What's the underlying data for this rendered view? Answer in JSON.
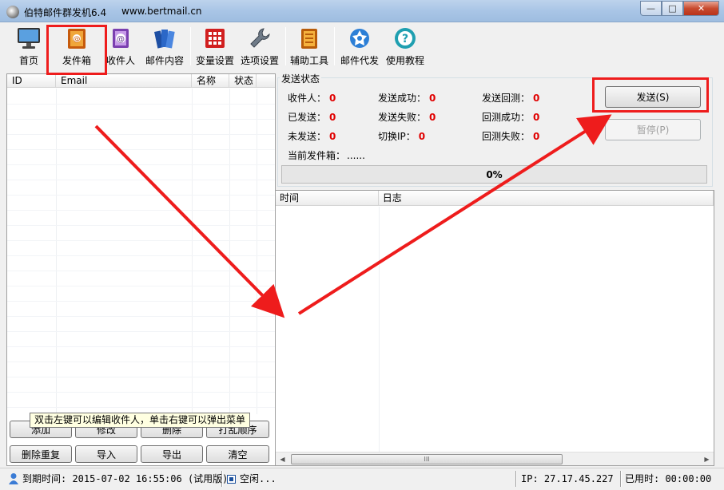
{
  "window": {
    "title": "伯特邮件群发机6.4",
    "url": "www.bertmail.cn",
    "minimize": "—",
    "maximize": "□",
    "close": "✕"
  },
  "toolbar": {
    "items": [
      {
        "label": "首页",
        "icon": "monitor-icon"
      },
      {
        "label": "发件箱",
        "icon": "outbox-icon"
      },
      {
        "label": "收件人",
        "icon": "recipients-icon"
      },
      {
        "label": "邮件内容",
        "icon": "mail-content-icon"
      },
      {
        "label": "变量设置",
        "icon": "variables-icon"
      },
      {
        "label": "选项设置",
        "icon": "wrench-icon"
      },
      {
        "label": "辅助工具",
        "icon": "tools-icon"
      },
      {
        "label": "邮件代发",
        "icon": "proxy-send-icon"
      },
      {
        "label": "使用教程",
        "icon": "help-icon"
      }
    ]
  },
  "recipient_list": {
    "columns": [
      "ID",
      "Email",
      "名称",
      "状态"
    ],
    "buttons_row1": [
      "添加",
      "修改",
      "删除",
      "打乱顺序"
    ],
    "buttons_row2": [
      "删除重复",
      "导入",
      "导出",
      "清空"
    ],
    "tooltip": "双击左键可以编辑收件人，单击右键可以弹出菜单"
  },
  "send_status": {
    "group_label": "发送状态",
    "stats": [
      {
        "label": "收件人：",
        "value": "0"
      },
      {
        "label": "发送成功：",
        "value": "0"
      },
      {
        "label": "发送回测：",
        "value": "0"
      },
      {
        "label": "已发送：",
        "value": "0"
      },
      {
        "label": "发送失败：",
        "value": "0"
      },
      {
        "label": "回测成功：",
        "value": "0"
      },
      {
        "label": "未发送：",
        "value": "0"
      },
      {
        "label": "切换IP：",
        "value": "0"
      },
      {
        "label": "回测失败：",
        "value": "0"
      }
    ],
    "current_sender_label": "当前发件箱：",
    "current_sender_value": "......",
    "progress_text": "0%",
    "progress": 0,
    "send_button": "发送(S)",
    "pause_button": "暂停(P)"
  },
  "log": {
    "columns": [
      "时间",
      "日志"
    ],
    "scroll_grip": "III"
  },
  "statusbar": {
    "expiry": "到期时间: 2015-07-02 16:55:06 (试用版)",
    "state": "空闲...",
    "ip": "IP: 27.17.45.227",
    "elapsed": "已用时: 00:00:00"
  },
  "colors": {
    "annotation_red": "#ee1c1c",
    "stat_value_red": "#e00000"
  }
}
